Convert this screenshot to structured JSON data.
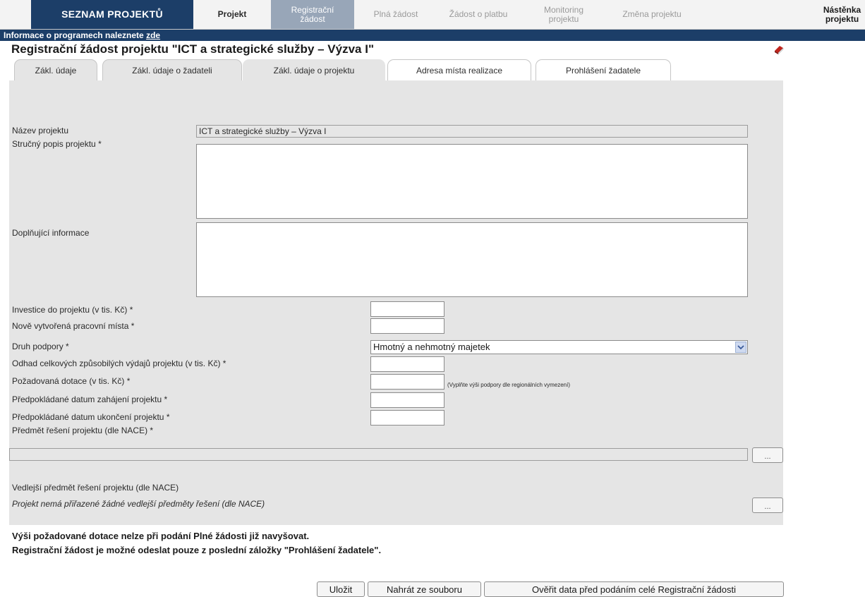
{
  "nav": {
    "tabs": [
      {
        "label": "SEZNAM PROJEKTŮ"
      },
      {
        "label": "Projekt"
      },
      {
        "label": "Registrační žádost"
      },
      {
        "label": "Plná žádost"
      },
      {
        "label": "Žádost o platbu"
      },
      {
        "label": "Monitoring projektu"
      },
      {
        "label": "Změna projektu"
      },
      {
        "label": "Nástěnka projektu"
      }
    ]
  },
  "info": {
    "text": "Informace o programech naleznete ",
    "link": "zde"
  },
  "page": {
    "title": "Registrační žádost projektu  \"ICT a strategické služby – Výzva I\""
  },
  "section_tabs": [
    {
      "label": "Zákl. údaje"
    },
    {
      "label": "Zákl. údaje o žadateli"
    },
    {
      "label": "Zákl. údaje o projektu"
    },
    {
      "label": "Adresa místa realizace"
    },
    {
      "label": "Prohlášení žadatele"
    }
  ],
  "form": {
    "nazev_label": "Název projektu",
    "nazev_value": "ICT a strategické služby – Výzva I",
    "popis_label": "Stručný popis projektu *",
    "popis_value": "",
    "doplnujici_label": "Doplňující informace",
    "doplnujici_value": "",
    "investice_label": "Investice do projektu (v tis. Kč) *",
    "investice_value": "",
    "mista_label": "Nově vytvořená pracovní místa *",
    "mista_value": "",
    "druh_label": "Druh podpory *",
    "druh_value": "Hmotný a nehmotný majetek",
    "odhad_label": "Odhad celkových způsobilých výdajů projektu (v tis. Kč) *",
    "odhad_value": "",
    "dotace_label": "Požadovaná dotace (v tis. Kč) *",
    "dotace_value": "",
    "dotace_hint": "(Vyplňte výši podpory dle regionálních vymezení)",
    "zahajeni_label": "Předpokládané datum zahájení projektu *",
    "zahajeni_value": "",
    "ukonceni_label": "Předpokládané datum ukončení projektu *",
    "ukonceni_value": "",
    "predmet_label": "Předmět řešení projektu (dle NACE) *",
    "predmet_value": "",
    "predmet_button": "...",
    "vedlejsi_label": "Vedlejší předmět řešení projektu (dle NACE)",
    "vedlejsi_note": "Projekt nemá přiřazené žádné vedlejší předměty řešení (dle NACE)",
    "vedlejsi_button": "..."
  },
  "notes": {
    "line1": "Výši požadované dotace nelze při podání Plné žádosti již navyšovat.",
    "line2": "Registrační žádost je možné odeslat pouze z poslední záložky \"Prohlášení žadatele\"."
  },
  "buttons": {
    "save": "Uložit",
    "load": "Nahrát ze souboru",
    "verify": "Ověřit data před podáním celé Registrační žádosti"
  },
  "colors": {
    "brand_blue": "#1c3e68",
    "active_tab": "#98a6b8",
    "panel_bg": "#e5e5e5"
  }
}
